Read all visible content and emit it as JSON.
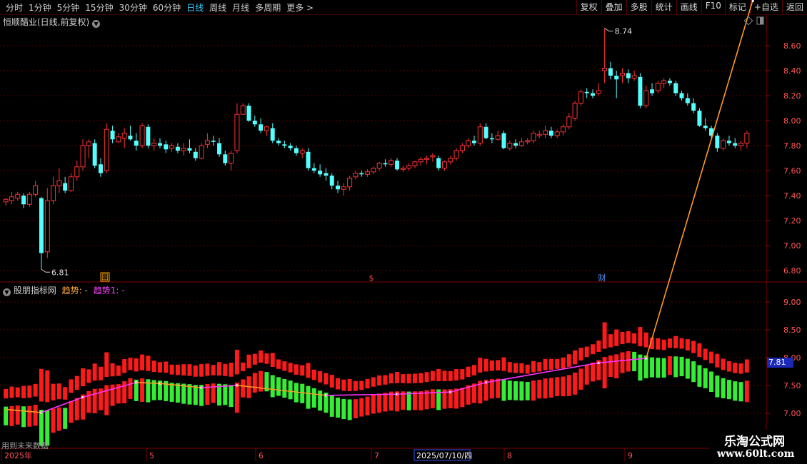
{
  "toolbar": {
    "periods": [
      {
        "label": "分时"
      },
      {
        "label": "1分钟"
      },
      {
        "label": "5分钟"
      },
      {
        "label": "15分钟"
      },
      {
        "label": "30分钟"
      },
      {
        "label": "60分钟"
      },
      {
        "label": "日线",
        "active": true
      },
      {
        "label": "周线"
      },
      {
        "label": "月线"
      },
      {
        "label": "多周期"
      },
      {
        "label": "更多 >"
      }
    ],
    "tools": [
      {
        "label": "复权"
      },
      {
        "label": "叠加"
      },
      {
        "label": "多股"
      },
      {
        "label": "统计"
      },
      {
        "label": "画线"
      },
      {
        "label": "F10"
      },
      {
        "label": "标记"
      },
      {
        "label": "+自选"
      },
      {
        "label": "返回"
      }
    ]
  },
  "main_panel": {
    "title": "恒顺醋业(日线,前复权)",
    "high_label": "8.74",
    "low_label": "6.81",
    "price_axis": [
      "8.60",
      "8.40",
      "8.20",
      "8.00",
      "7.80",
      "7.60",
      "7.40",
      "7.20",
      "7.00",
      "6.80"
    ],
    "markers": [
      {
        "label": "回",
        "kind": "box"
      },
      {
        "label": "$",
        "kind": "text"
      },
      {
        "label": "财",
        "kind": "text"
      }
    ]
  },
  "indicator_panel": {
    "name": "股朋指标网",
    "line1": "趋势: -",
    "line2": "趋势1: -",
    "axis": [
      "9.00",
      "8.50",
      "8.00",
      "7.50",
      "7.00"
    ],
    "current_value": "7.81",
    "futures_note": "用到未来数据"
  },
  "date_axis": {
    "labels": [
      "2025年",
      "5",
      "6",
      "7",
      "8",
      "9"
    ],
    "cursor_date": "2025/07/10/四"
  },
  "watermark": {
    "line1": "乐淘公式网",
    "line2": "www.60lt.com"
  },
  "colors": {
    "up": "#ff3333",
    "down": "#54ffff",
    "bar_red": "#ff1a1a",
    "bar_green": "#33ee33",
    "trend_up": "#ff33ff",
    "trend_down": "#ff9a22"
  },
  "chart_data": {
    "type": "candlestick",
    "ylim": [
      6.8,
      8.74
    ],
    "candles": [
      [
        7.35,
        7.38,
        7.32,
        7.37
      ],
      [
        7.36,
        7.43,
        7.33,
        7.39
      ],
      [
        7.38,
        7.43,
        7.36,
        7.41
      ],
      [
        7.4,
        7.42,
        7.3,
        7.33
      ],
      [
        7.33,
        7.43,
        7.31,
        7.41
      ],
      [
        7.41,
        7.52,
        7.39,
        7.48
      ],
      [
        7.38,
        7.39,
        6.81,
        6.94
      ],
      [
        6.95,
        7.46,
        6.9,
        7.36
      ],
      [
        7.36,
        7.55,
        7.33,
        7.48
      ],
      [
        7.48,
        7.62,
        7.42,
        7.52
      ],
      [
        7.5,
        7.55,
        7.42,
        7.44
      ],
      [
        7.44,
        7.58,
        7.43,
        7.55
      ],
      [
        7.55,
        7.68,
        7.52,
        7.63
      ],
      [
        7.63,
        7.85,
        7.6,
        7.8
      ],
      [
        7.8,
        7.85,
        7.7,
        7.83
      ],
      [
        7.82,
        7.85,
        7.62,
        7.64
      ],
      [
        7.65,
        7.7,
        7.55,
        7.58
      ],
      [
        7.6,
        7.98,
        7.58,
        7.93
      ],
      [
        7.92,
        7.96,
        7.82,
        7.85
      ],
      [
        7.83,
        7.9,
        7.82,
        7.87
      ],
      [
        7.86,
        7.94,
        7.78,
        7.9
      ],
      [
        7.88,
        7.96,
        7.84,
        7.85
      ],
      [
        7.84,
        7.9,
        7.76,
        7.8
      ],
      [
        7.8,
        7.98,
        7.78,
        7.96
      ],
      [
        7.95,
        7.97,
        7.78,
        7.8
      ],
      [
        7.8,
        7.86,
        7.76,
        7.82
      ],
      [
        7.82,
        7.86,
        7.78,
        7.8
      ],
      [
        7.81,
        7.84,
        7.74,
        7.77
      ],
      [
        7.78,
        7.82,
        7.75,
        7.8
      ],
      [
        7.79,
        7.82,
        7.74,
        7.76
      ],
      [
        7.76,
        7.82,
        7.72,
        7.78
      ],
      [
        7.78,
        7.85,
        7.74,
        7.76
      ],
      [
        7.75,
        7.78,
        7.68,
        7.7
      ],
      [
        7.7,
        7.82,
        7.69,
        7.8
      ],
      [
        7.81,
        7.9,
        7.78,
        7.84
      ],
      [
        7.84,
        7.88,
        7.8,
        7.83
      ],
      [
        7.82,
        7.86,
        7.71,
        7.73
      ],
      [
        7.73,
        7.76,
        7.64,
        7.66
      ],
      [
        7.66,
        7.76,
        7.6,
        7.74
      ],
      [
        7.76,
        8.14,
        7.74,
        8.05
      ],
      [
        8.05,
        8.14,
        8.1,
        8.12
      ],
      [
        8.12,
        8.14,
        7.99,
        8.0
      ],
      [
        8.0,
        8.04,
        7.95,
        7.97
      ],
      [
        7.97,
        8.02,
        7.9,
        7.92
      ],
      [
        7.92,
        7.96,
        7.88,
        7.95
      ],
      [
        7.94,
        7.98,
        7.82,
        7.84
      ],
      [
        7.84,
        7.86,
        7.8,
        7.82
      ],
      [
        7.81,
        7.84,
        7.78,
        7.8
      ],
      [
        7.8,
        7.82,
        7.76,
        7.78
      ],
      [
        7.78,
        7.8,
        7.72,
        7.74
      ],
      [
        7.74,
        7.78,
        7.7,
        7.76
      ],
      [
        7.75,
        7.78,
        7.6,
        7.62
      ],
      [
        7.62,
        7.66,
        7.58,
        7.6
      ],
      [
        7.6,
        7.65,
        7.55,
        7.57
      ],
      [
        7.58,
        7.62,
        7.52,
        7.56
      ],
      [
        7.56,
        7.58,
        7.45,
        7.48
      ],
      [
        7.48,
        7.52,
        7.42,
        7.45
      ],
      [
        7.45,
        7.5,
        7.4,
        7.47
      ],
      [
        7.47,
        7.56,
        7.44,
        7.54
      ],
      [
        7.55,
        7.6,
        7.53,
        7.58
      ],
      [
        7.58,
        7.6,
        7.55,
        7.57
      ],
      [
        7.57,
        7.61,
        7.55,
        7.59
      ],
      [
        7.59,
        7.63,
        7.57,
        7.62
      ],
      [
        7.62,
        7.67,
        7.6,
        7.66
      ],
      [
        7.66,
        7.69,
        7.63,
        7.65
      ],
      [
        7.65,
        7.7,
        7.63,
        7.68
      ],
      [
        7.68,
        7.7,
        7.6,
        7.61
      ],
      [
        7.61,
        7.64,
        7.59,
        7.62
      ],
      [
        7.62,
        7.66,
        7.6,
        7.64
      ],
      [
        7.64,
        7.68,
        7.62,
        7.67
      ],
      [
        7.67,
        7.71,
        7.64,
        7.69
      ],
      [
        7.69,
        7.72,
        7.65,
        7.7
      ],
      [
        7.71,
        7.74,
        7.67,
        7.72
      ],
      [
        7.7,
        7.72,
        7.6,
        7.62
      ],
      [
        7.62,
        7.68,
        7.6,
        7.67
      ],
      [
        7.67,
        7.72,
        7.65,
        7.7
      ],
      [
        7.7,
        7.78,
        7.68,
        7.76
      ],
      [
        7.76,
        7.82,
        7.74,
        7.8
      ],
      [
        7.8,
        7.86,
        7.78,
        7.84
      ],
      [
        7.84,
        7.88,
        7.8,
        7.82
      ],
      [
        7.82,
        7.98,
        7.8,
        7.95
      ],
      [
        7.95,
        7.98,
        7.85,
        7.86
      ],
      [
        7.86,
        7.9,
        7.82,
        7.85
      ],
      [
        7.85,
        7.92,
        7.84,
        7.88
      ],
      [
        7.9,
        7.92,
        7.77,
        7.78
      ],
      [
        7.78,
        7.84,
        7.76,
        7.82
      ],
      [
        7.82,
        7.85,
        7.78,
        7.8
      ],
      [
        7.8,
        7.86,
        7.79,
        7.83
      ],
      [
        7.83,
        7.86,
        7.81,
        7.84
      ],
      [
        7.84,
        7.92,
        7.82,
        7.9
      ],
      [
        7.88,
        7.92,
        7.86,
        7.89
      ],
      [
        7.89,
        7.96,
        7.86,
        7.92
      ],
      [
        7.92,
        7.95,
        7.86,
        7.88
      ],
      [
        7.88,
        7.93,
        7.86,
        7.91
      ],
      [
        7.91,
        7.97,
        7.88,
        7.95
      ],
      [
        7.95,
        8.06,
        7.93,
        8.03
      ],
      [
        8.02,
        8.16,
        8.0,
        8.14
      ],
      [
        8.14,
        8.25,
        8.12,
        8.23
      ],
      [
        8.23,
        8.26,
        8.18,
        8.22
      ],
      [
        8.22,
        8.25,
        8.18,
        8.2
      ],
      [
        8.22,
        8.3,
        8.2,
        8.24
      ],
      [
        8.4,
        8.74,
        8.3,
        8.42
      ],
      [
        8.42,
        8.47,
        8.33,
        8.36
      ],
      [
        8.36,
        8.4,
        8.18,
        8.33
      ],
      [
        8.36,
        8.42,
        8.3,
        8.38
      ],
      [
        8.38,
        8.41,
        8.3,
        8.34
      ],
      [
        8.34,
        8.4,
        8.32,
        8.36
      ],
      [
        8.35,
        8.38,
        8.1,
        8.12
      ],
      [
        8.12,
        8.28,
        8.1,
        8.24
      ],
      [
        8.25,
        8.3,
        8.2,
        8.22
      ],
      [
        8.24,
        8.32,
        8.22,
        8.3
      ],
      [
        8.3,
        8.34,
        8.26,
        8.32
      ],
      [
        8.32,
        8.34,
        8.28,
        8.3
      ],
      [
        8.3,
        8.32,
        8.2,
        8.22
      ],
      [
        8.22,
        8.24,
        8.16,
        8.18
      ],
      [
        8.18,
        8.22,
        8.12,
        8.14
      ],
      [
        8.14,
        8.18,
        8.06,
        8.08
      ],
      [
        8.08,
        8.1,
        7.95,
        7.96
      ],
      [
        7.96,
        8.02,
        7.92,
        7.94
      ],
      [
        7.94,
        7.96,
        7.85,
        7.88
      ],
      [
        7.88,
        7.9,
        7.75,
        7.78
      ],
      [
        7.78,
        7.86,
        7.76,
        7.84
      ],
      [
        7.84,
        7.88,
        7.8,
        7.82
      ],
      [
        7.82,
        7.86,
        7.78,
        7.8
      ],
      [
        7.8,
        7.84,
        7.76,
        7.82
      ],
      [
        7.82,
        7.92,
        7.78,
        7.9
      ]
    ]
  }
}
